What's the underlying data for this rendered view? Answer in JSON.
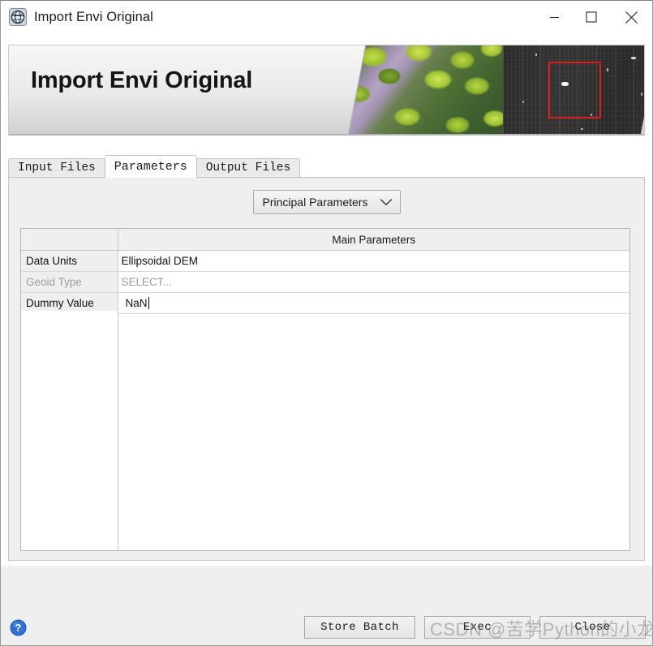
{
  "window": {
    "title": "Import Envi Original",
    "app_icon": "globe-icon",
    "controls": {
      "minimize": "minimize-icon",
      "maximize": "maximize-icon",
      "close": "close-icon"
    }
  },
  "banner": {
    "title": "Import Envi Original",
    "image_left": "aerial-optical-forest-image",
    "image_right": "sar-grayscale-image",
    "annotation_color": "#e01b1b"
  },
  "tabs": [
    {
      "label": "Input Files",
      "active": false
    },
    {
      "label": "Parameters",
      "active": true
    },
    {
      "label": "Output Files",
      "active": false
    }
  ],
  "parameters_panel": {
    "group_selector": {
      "value": "Principal Parameters",
      "arrow_icon": "chevron-down-icon"
    },
    "table": {
      "headers": [
        "",
        "Main Parameters"
      ],
      "rows": [
        {
          "key": "Data Units",
          "value": "Ellipsoidal DEM",
          "disabled": false,
          "placeholder": false,
          "editing": false
        },
        {
          "key": "Geoid Type",
          "value": "SELECT...",
          "disabled": true,
          "placeholder": true,
          "editing": false
        },
        {
          "key": "Dummy Value",
          "value": "NaN",
          "disabled": false,
          "placeholder": false,
          "editing": true
        }
      ]
    }
  },
  "footer": {
    "help_label": "?",
    "buttons": [
      {
        "label": "Store Batch"
      },
      {
        "label": "Exec"
      },
      {
        "label": "Close"
      }
    ]
  },
  "watermark": {
    "text": "CSDN @苦学Python的小龙"
  }
}
